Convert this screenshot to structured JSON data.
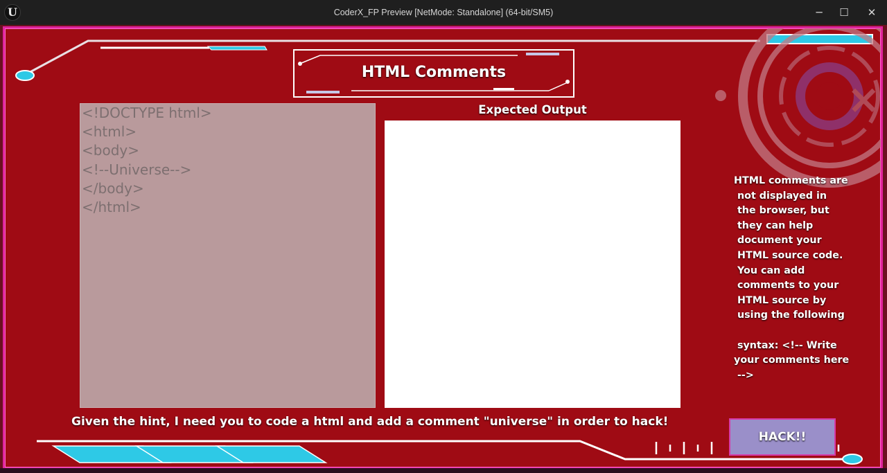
{
  "window": {
    "title": "CoderX_FP Preview [NetMode: Standalone]  (64-bit/SM5)",
    "logo_letter": "U",
    "minimize_icon": "─",
    "maximize_icon": "☐",
    "close_icon": "✕"
  },
  "game": {
    "title": "HTML Comments",
    "code_lines": [
      "<!DOCTYPE html>",
      "<html>",
      "<body>",
      "<!--Universe-->",
      "</body>",
      "</html>"
    ],
    "expected_output_label": "Expected Output",
    "hint_lines": [
      "HTML comments are",
      " not displayed in",
      " the browser, but",
      " they can help",
      " document your",
      " HTML source code.",
      " You can add",
      " comments to your",
      " HTML source by",
      " using the following",
      "",
      " syntax: <!-- Write",
      "your comments here",
      " -->"
    ],
    "instruction": "Given the hint, I need you to code a html and add a comment \"universe\" in order to hack!",
    "hack_button_label": "HACK!!",
    "logo_text": "CX"
  },
  "colors": {
    "background": "#9f0b14",
    "frame_border": "#e0239c",
    "accent_cyan": "#2ec9e6",
    "code_panel": "#b99a9c",
    "hack_button": "#9a8fc9"
  }
}
